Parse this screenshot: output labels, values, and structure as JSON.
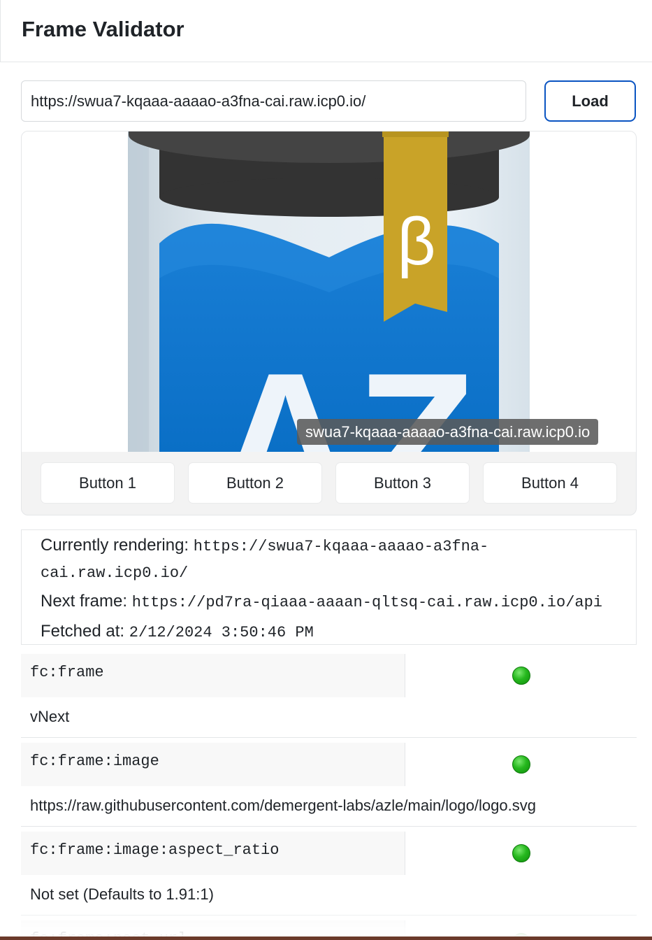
{
  "app": {
    "title": "Frame Validator"
  },
  "url_bar": {
    "value": "https://swua7-kqaaa-aaaao-a3fna-cai.raw.icp0.io/",
    "load_label": "Load"
  },
  "frame": {
    "image_text": {
      "beta": "β",
      "logo": "AZ"
    },
    "tooltip": "swua7-kqaaa-aaaao-a3fna-cai.raw.icp0.io",
    "buttons": [
      {
        "label": "Button 1"
      },
      {
        "label": "Button 2"
      },
      {
        "label": "Button 3"
      },
      {
        "label": "Button 4"
      }
    ]
  },
  "info": {
    "currently_label": "Currently rendering:",
    "currently_value_1": "https://swua7-kqaaa-aaaao-a3fna-",
    "currently_value_2": "cai.raw.icp0.io/",
    "next_label": "Next frame:",
    "next_value": "https://pd7ra-qiaaa-aaaan-qltsq-cai.raw.icp0.io/api",
    "fetched_label": "Fetched at:",
    "fetched_value": "2/12/2024 3:50:46 PM"
  },
  "tags": [
    {
      "key": "fc:frame",
      "status": "valid",
      "value": "vNext"
    },
    {
      "key": "fc:frame:image",
      "status": "valid",
      "value": "https://raw.githubusercontent.com/demergent-labs/azle/main/logo/logo.svg"
    },
    {
      "key": "fc:frame:image:aspect_ratio",
      "status": "valid",
      "value": "Not set (Defaults to 1.91:1)"
    },
    {
      "key": "fc:frame:post_url",
      "status": "valid",
      "value": ""
    }
  ],
  "colors": {
    "accent": "#0a54c2",
    "status_valid": "#26b81e",
    "logo_blue": "#0a78d1",
    "ribbon_gold": "#c9a328",
    "cap_dark": "#3d3d3d"
  }
}
